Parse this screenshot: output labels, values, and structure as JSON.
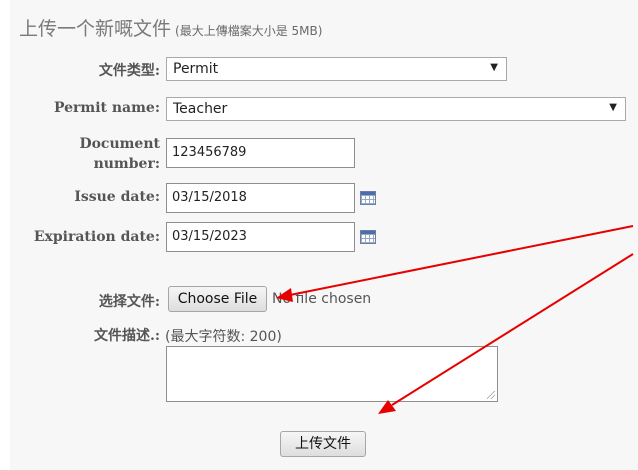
{
  "header": {
    "title": "上传一个新嘅文件",
    "size_note": "(最大上傳檔案大小是 5MB)"
  },
  "form": {
    "file_type_label": "文件类型:",
    "file_type_value": "Permit",
    "permit_name_label": "Permit name:",
    "permit_name_value": "Teacher",
    "document_number_label_line1": "Document",
    "document_number_label_line2": "number:",
    "document_number_value": "123456789",
    "issue_date_label": "Issue date:",
    "issue_date_value": "03/15/2018",
    "expiration_date_label": "Expiration date:",
    "expiration_date_value": "03/15/2023",
    "choose_file_label": "选择文件:",
    "choose_file_button": "Choose File",
    "no_file_text": "No file chosen",
    "description_label": "文件描述.:",
    "description_hint": "(最大字符数: 200)",
    "description_value": "",
    "upload_button": "上传文件"
  },
  "icons": {
    "dropdown_arrow": "▼",
    "calendar": "calendar-icon"
  },
  "colors": {
    "annotation_arrow": "#e60000",
    "panel_background": "#f7f7f7"
  }
}
